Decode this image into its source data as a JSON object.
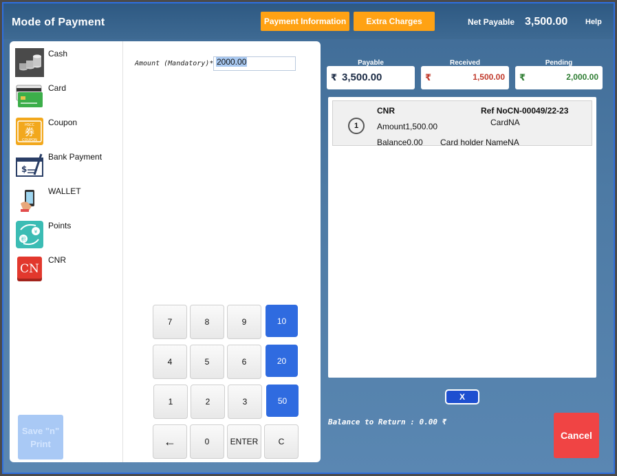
{
  "header": {
    "title": "Mode of Payment",
    "payment_info_label": "Payment Information",
    "extra_charges_label": "Extra Charges",
    "net_payable_label": "Net Payable",
    "net_payable_value": "3,500.00",
    "help_label": "Help"
  },
  "modes": [
    {
      "label": "Cash",
      "icon": "cash-icon"
    },
    {
      "label": "Card",
      "icon": "card-icon"
    },
    {
      "label": "Coupon",
      "icon": "coupon-icon"
    },
    {
      "label": "Bank Payment",
      "icon": "bank-payment-icon"
    },
    {
      "label": "WALLET",
      "icon": "wallet-icon"
    },
    {
      "label": "Points",
      "icon": "points-icon"
    },
    {
      "label": "CNR",
      "icon": "cnr-icon"
    }
  ],
  "amount": {
    "label": "Amount (Mandatory)*",
    "value": "2000.00"
  },
  "keypad": {
    "rows": [
      [
        "7",
        "8",
        "9",
        "10"
      ],
      [
        "4",
        "5",
        "6",
        "20"
      ],
      [
        "1",
        "2",
        "3",
        "50"
      ],
      [
        "←",
        "0",
        "ENTER",
        "C"
      ]
    ]
  },
  "save_label": "Save \"n\" Print",
  "summary": {
    "currency_symbol": "₹",
    "payable_label": "Payable",
    "payable_value": "3,500.00",
    "received_label": "Received",
    "received_value": "1,500.00",
    "pending_label": "Pending",
    "pending_value": "2,000.00",
    "colors": {
      "received": "#c0392b",
      "pending": "#2e7d32",
      "payable": "#1a2a44"
    }
  },
  "entries": [
    {
      "index": "1",
      "mode": "CNR",
      "amount": "Amount1,500.00",
      "balance": "Balance0.00",
      "ref": "Ref NoCN-00049/22-23",
      "card": "CardNA",
      "card_holder": "Card holder NameNA"
    }
  ],
  "remove_label": "X",
  "balance_return": "Balance to Return : 0.00  ₹",
  "cancel_label": "Cancel"
}
